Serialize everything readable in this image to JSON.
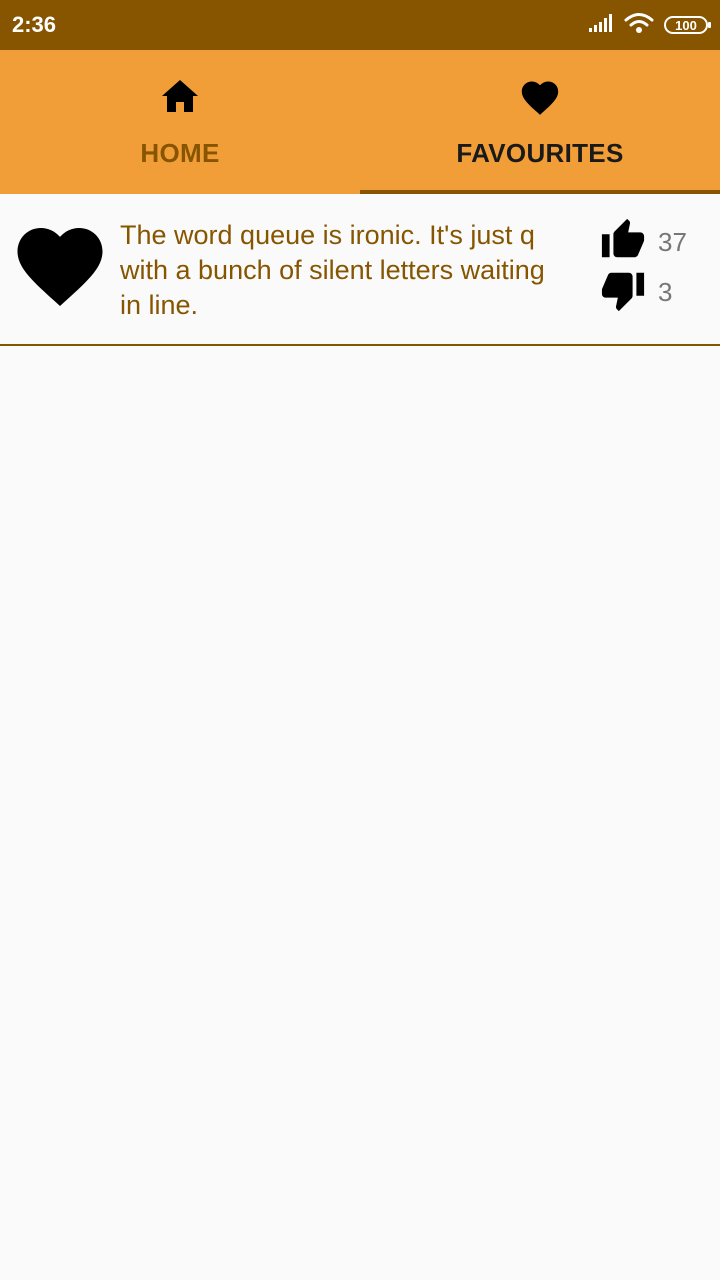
{
  "status_bar": {
    "time": "2:36",
    "battery": "100",
    "icons": [
      "signal-icon",
      "wifi-icon",
      "battery-icon"
    ]
  },
  "tabs": [
    {
      "label": "HOME",
      "icon": "home-icon",
      "selected": false
    },
    {
      "label": "FAVOURITES",
      "icon": "heart-icon",
      "selected": true
    }
  ],
  "jokes": [
    {
      "text": "The word queue is ironic. It's just q with a bunch of silent letters waiting in line.",
      "favourite_icon": "heart-icon",
      "likes": "37",
      "dislikes": "3"
    }
  ],
  "colors": {
    "status_bar": "#875500",
    "tab_bar": "#f29e38",
    "accent": "#875500",
    "background": "#fafafa"
  }
}
